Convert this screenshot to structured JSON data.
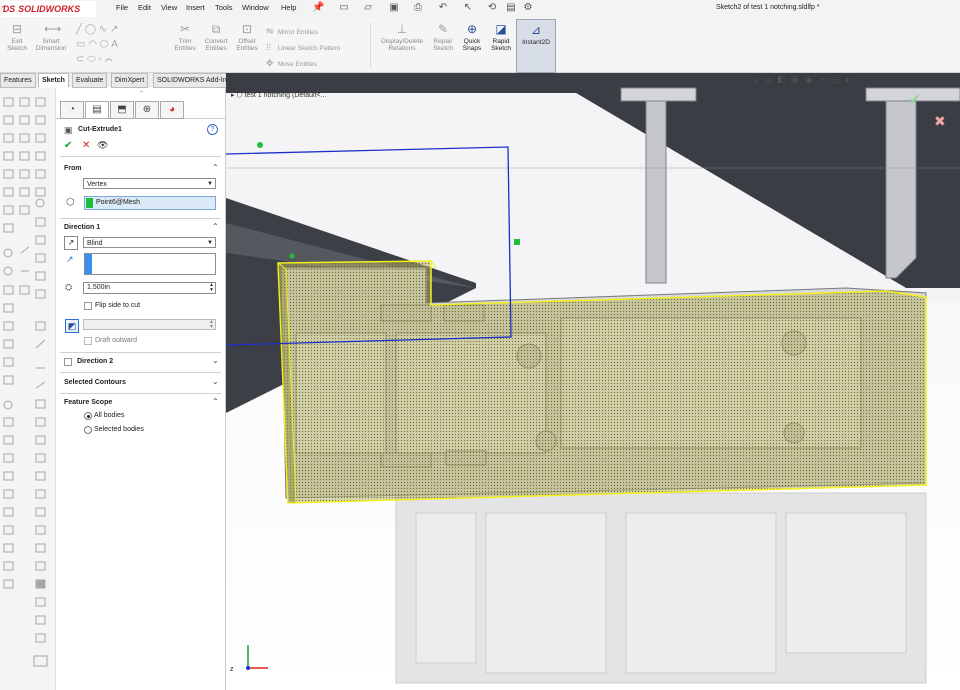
{
  "app": {
    "name": "SOLIDWORKS",
    "document_title": "Sketch2 of test 1 notching.sldlfp *"
  },
  "menu": [
    "File",
    "Edit",
    "View",
    "Insert",
    "Tools",
    "Window",
    "Help"
  ],
  "commands": {
    "exit_sketch": "Exit Sketch",
    "smart_dimension": "Smart Dimension",
    "trim_entities": "Trim Entities",
    "convert_entities": "Convert Entities",
    "offset_entities": "Offset Entities",
    "mirror_entities": "Mirror Entities",
    "linear_sketch_pattern": "Linear Sketch Pattern",
    "move_entities": "Move Entities",
    "display_delete_relations": "Display/Delete Relations",
    "repair_sketch": "Repair Sketch",
    "quick_snaps": "Quick Snaps",
    "rapid_sketch": "Rapid Sketch",
    "instant2d": "Instant2D"
  },
  "tabs": [
    "Features",
    "Sketch",
    "Evaluate",
    "DimXpert",
    "SOLIDWORKS Add-Ins"
  ],
  "active_tab": "Sketch",
  "property_manager": {
    "title": "Cut-Extrude1",
    "from": {
      "label": "From",
      "value": "Vertex",
      "selection": "Point6@Mesh"
    },
    "direction1": {
      "label": "Direction 1",
      "end_condition": "Blind",
      "depth": "1.500in",
      "flip_side": "Flip side to cut",
      "draft_outward": "Draft outward"
    },
    "direction2": {
      "label": "Direction 2"
    },
    "selected_contours": {
      "label": "Selected Contours"
    },
    "feature_scope": {
      "label": "Feature Scope",
      "option_all": "All bodies",
      "option_selected": "Selected bodies"
    }
  },
  "tree": {
    "label": "test 1 notching  (Default<..."
  },
  "colors": {
    "accent": "#2a4f9a",
    "preview_fill": "#b8b46a",
    "preview_edge": "#f3f020",
    "sketch_line": "#1b2fc8",
    "selection_green": "#1fbf3a",
    "logo_red": "#d0242a"
  }
}
